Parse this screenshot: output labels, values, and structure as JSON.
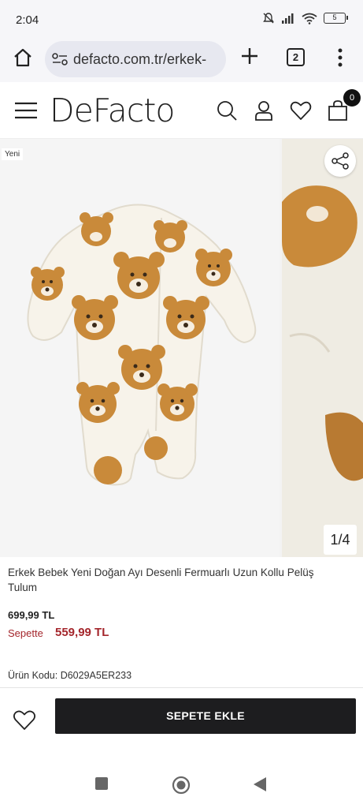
{
  "status": {
    "time": "2:04",
    "battery": "5"
  },
  "browser": {
    "url": "defacto.com.tr/erkek-",
    "tab_count": "2"
  },
  "header": {
    "logo": "DeFacto",
    "cart_count": "0"
  },
  "gallery": {
    "badge": "Yeni",
    "counter": "1/4"
  },
  "product": {
    "title": "Erkek Bebek Yeni Doğan Ayı Desenli Fermuarlı Uzun Kollu Pelüş Tulum",
    "price": "699,99 TL",
    "cart_label": "Sepette",
    "cart_price": "559,99 TL",
    "code": "Ürün Kodu: D6029A5ER233"
  },
  "buy_bar": {
    "add_to_cart": "SEPETE EKLE"
  },
  "colors": {
    "accent": "#a4262c",
    "button": "#1d1d1f",
    "bear": "#c98a3a"
  }
}
